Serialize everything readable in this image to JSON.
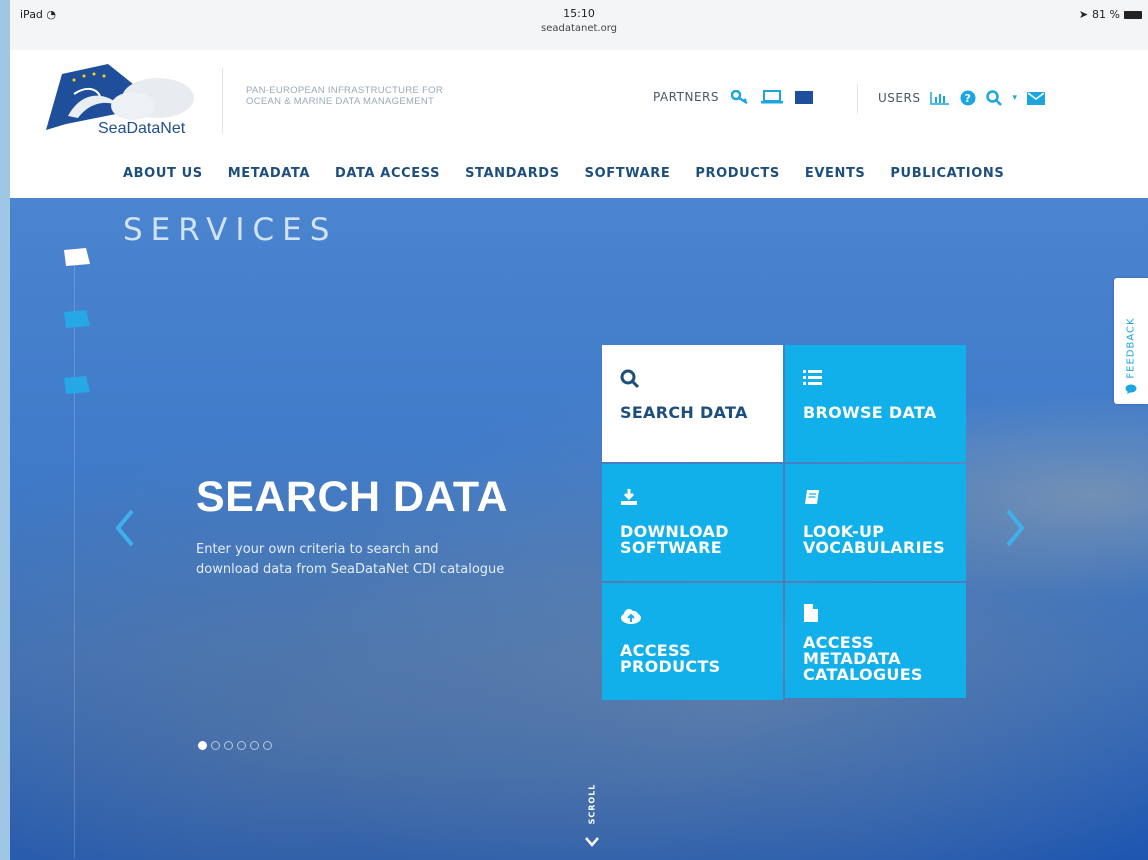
{
  "status_bar": {
    "device": "iPad",
    "time": "15:10",
    "url": "seadatanet.org",
    "battery": "81 %"
  },
  "header": {
    "logo_text": "SeaDataNet",
    "tagline_line1": "PAN-EUROPEAN INFRASTRUCTURE FOR",
    "tagline_line2": "OCEAN & MARINE DATA MANAGEMENT",
    "partners_label": "PARTNERS",
    "users_label": "USERS",
    "icons": [
      "key-icon",
      "laptop-icon",
      "eu-flag-icon",
      "bar-chart-icon",
      "help-icon",
      "search-icon",
      "mail-icon"
    ]
  },
  "nav": {
    "items": [
      "ABOUT US",
      "METADATA",
      "DATA ACCESS",
      "STANDARDS",
      "SOFTWARE",
      "PRODUCTS",
      "EVENTS",
      "PUBLICATIONS"
    ]
  },
  "hero": {
    "section_title": "SERVICES",
    "slide_heading": "SEARCH DATA",
    "slide_desc_line1": "Enter your own criteria to search and",
    "slide_desc_line2": "download data from SeaDataNet CDI catalogue",
    "dots_count": 6,
    "active_dot": 1,
    "feedback_label": "FEEDBACK",
    "scroll_label": "SCROLL"
  },
  "tiles": [
    {
      "label": "SEARCH DATA",
      "icon": "search-icon",
      "active": true
    },
    {
      "label": "BROWSE DATA",
      "icon": "list-icon",
      "active": false
    },
    {
      "label": "DOWNLOAD\nSOFTWARE",
      "icon": "download-icon",
      "active": false
    },
    {
      "label": "LOOK-UP\nVOCABULARIES",
      "icon": "book-icon",
      "active": false
    },
    {
      "label": "ACCESS\nPRODUCTS",
      "icon": "cloud-upload-icon",
      "active": false
    },
    {
      "label": "ACCESS\nMETADATA\nCATALOGUES",
      "icon": "document-icon",
      "active": false
    }
  ],
  "colors": {
    "accent": "#11b0ea",
    "nav_text": "#1e4f7c",
    "hero_blue": "#3f7bc9"
  }
}
